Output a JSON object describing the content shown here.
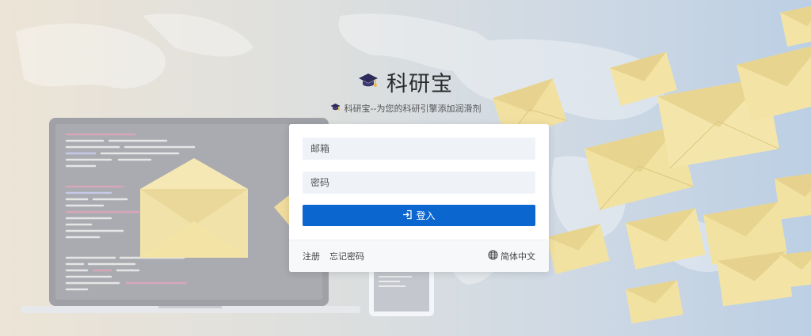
{
  "brand": {
    "name": "科研宝",
    "slogan": "科研宝--为您的科研引擎添加润滑剂"
  },
  "login_form": {
    "email_placeholder": "邮箱",
    "password_placeholder": "密码",
    "submit_label": "登入"
  },
  "footer": {
    "register_label": "注册",
    "forgot_password_label": "忘记密码",
    "language_label": "简体中文"
  },
  "icons": {
    "logo": "graduation-cap-icon",
    "login": "login-arrow-icon",
    "language": "globe-icon"
  },
  "colors": {
    "primary": "#0b66d0",
    "input_bg": "#eff3f8",
    "envelope": "#f3e3a3"
  }
}
